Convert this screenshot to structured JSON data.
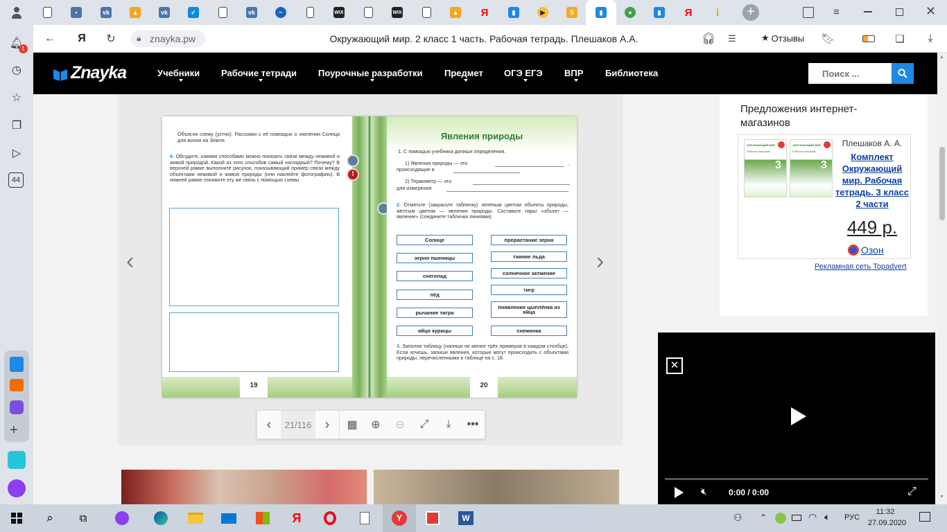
{
  "tabs": {
    "icons": [
      "profile-icon",
      "doc-icon",
      "chat-icon",
      "vk-icon",
      "image-icon",
      "vk-icon",
      "check-icon",
      "doc-icon",
      "vk-icon",
      "feather-icon",
      "doc-icon",
      "wix-icon",
      "doc-icon",
      "wix-icon",
      "doc-icon",
      "image-icon",
      "yandex-icon",
      "book-icon",
      "play-icon",
      "coin-icon",
      "znayka-icon",
      "leaf-icon",
      "book-icon",
      "yandex-icon",
      "info-icon"
    ],
    "new_tab": "+"
  },
  "omnibox": {
    "domain": "znayka.pw",
    "title": "Окружающий мир. 2 класс 1 часть. Рабочая тетрадь. Плешаков А.А.",
    "reviews": "Отзывы",
    "yandex": "Я"
  },
  "sidebar": {
    "notif_badge": "1",
    "counter": "44"
  },
  "site": {
    "logo": "Znayka",
    "nav": [
      "Учебники",
      "Рабочие тетради",
      "Поурочные разработки",
      "Предмет",
      "ОГЭ ЕГЭ",
      "ВПР",
      "Библиотека"
    ],
    "search_placeholder": "Поиск ..."
  },
  "book": {
    "left": {
      "intro": "Объясни схему (устно). Расскажи с её помощью о значении Солнца для жизни на Земле.",
      "task_num": "6.",
      "task6": "Обсудите, какими способами можно показать связи между неживой и живой природой. Какой из этих способов самый наглядный? Почему? В верхней рамке выполните рисунок, показывающий пример связи между объектами неживой и живой природы (или наклейте фотографию). В нижней рамке покажите эту же связь с помощью схемы.",
      "page_num": "19"
    },
    "right": {
      "title": "Явления природы",
      "task1_num": "1.",
      "task1": "С помощью учебника допиши определения.",
      "def1a": "1) Явления природы — это",
      "def1b": "происходящие в",
      "def2a": "2) Термометр — это",
      "def2b": "для измерения",
      "task2_num": "2.",
      "task2": "Отметьте (закрасьте табличку) зелёным цветом объекты природы, жёлтым цветом — явления природы. Составьте пары «объект — явление» (соедините таблички линиями).",
      "objects": [
        "Солнце",
        "зерно пшеницы",
        "снегопад",
        "лёд",
        "рычание тигра",
        "яйцо курицы"
      ],
      "phenomena": [
        "прорастание зерна",
        "таяние льда",
        "солнечное затмение",
        "тигр",
        "появление цыплёнка из яйца",
        "снежинка"
      ],
      "task3_num": "3.",
      "task3": "Заполни таблицу (напиши не менее трёх примеров в каждом столбце). Если хочешь, запиши явления, которые могут происходить с объектами природы, перечисленными в таблице на с. 18.",
      "page_num": "20"
    }
  },
  "viewer_toolbar": {
    "page_indicator": "21/116"
  },
  "ad": {
    "heading": "Предложения интернет-магазинов",
    "author": "Плешаков А. А.",
    "product": "Комплект Окружающий мир. Рабочая тетрадь. 3 класс 2 части",
    "price": "449 р.",
    "shop": "Озон",
    "network": "Рекламная сеть Topadvert",
    "cover_title": "ОКРУЖАЮЩИЙ МИР",
    "cover_sub": "Рабочая тетрадь",
    "cover_grade": "3"
  },
  "video": {
    "time": "0:00 / 0:00"
  },
  "taskbar": {
    "lang": "РУС",
    "time": "11:32",
    "date": "27.09.2020"
  },
  "colors": {
    "accent": "#1e88e5",
    "green": "#2e7d32",
    "box_border": "#3a7fc0"
  }
}
